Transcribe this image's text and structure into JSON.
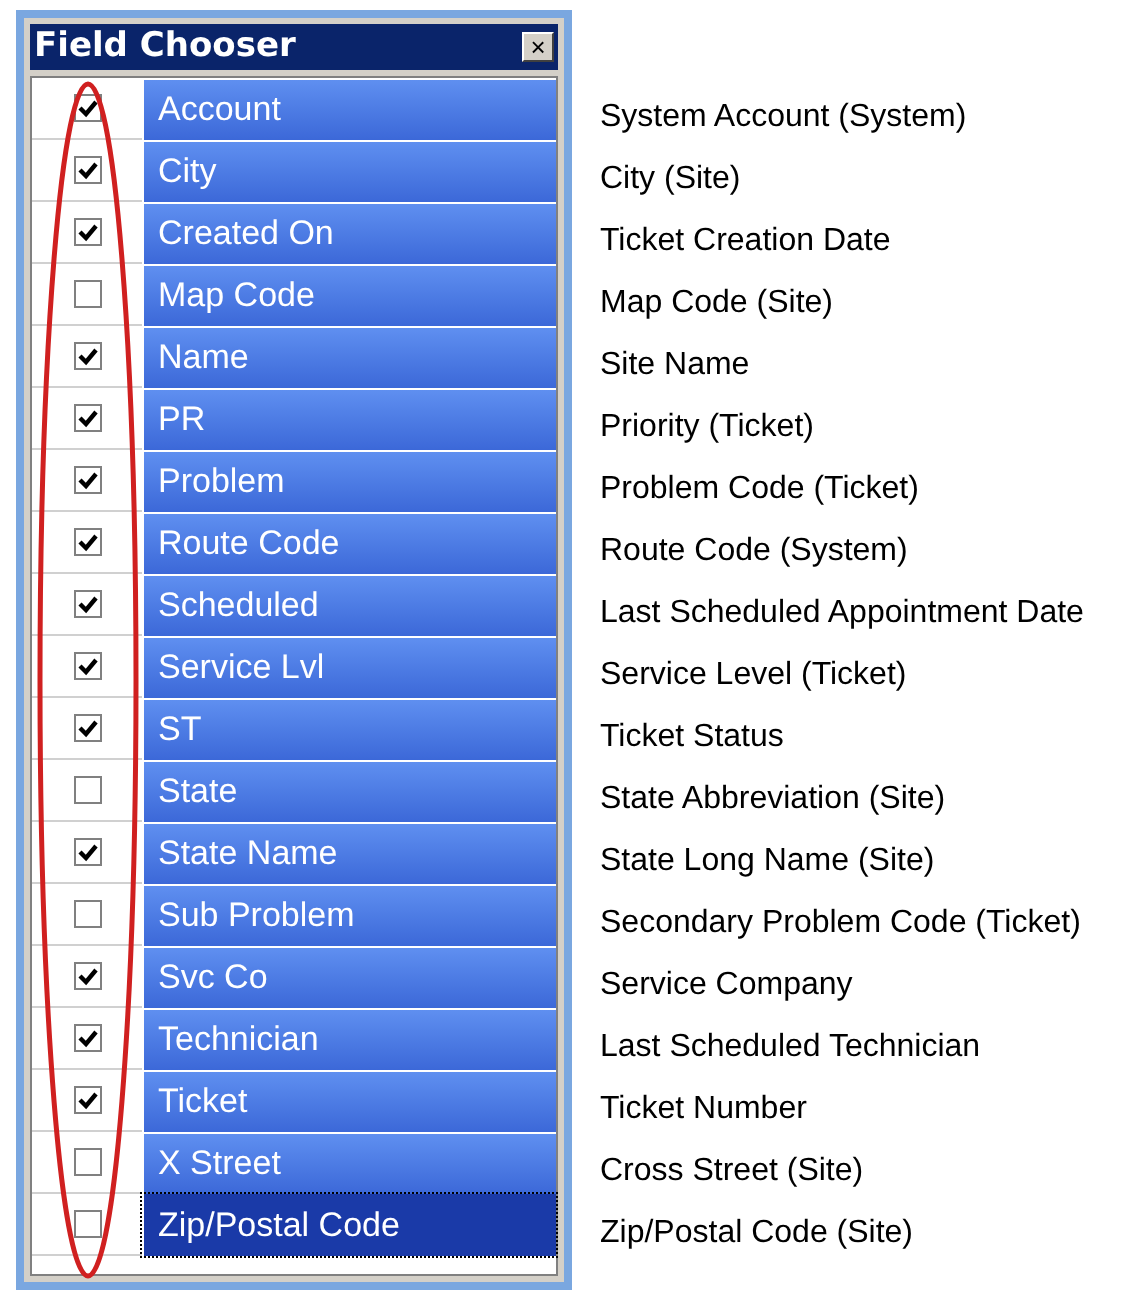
{
  "window": {
    "title": "Field Chooser",
    "close": "×"
  },
  "fields": [
    {
      "label": "Account",
      "description": "System Account (System)",
      "checked": true,
      "selected": false
    },
    {
      "label": "City",
      "description": "City (Site)",
      "checked": true,
      "selected": false
    },
    {
      "label": "Created On",
      "description": "Ticket Creation Date",
      "checked": true,
      "selected": false
    },
    {
      "label": "Map Code",
      "description": "Map Code (Site)",
      "checked": false,
      "selected": false
    },
    {
      "label": "Name",
      "description": "Site Name",
      "checked": true,
      "selected": false
    },
    {
      "label": "PR",
      "description": "Priority (Ticket)",
      "checked": true,
      "selected": false
    },
    {
      "label": "Problem",
      "description": "Problem Code (Ticket)",
      "checked": true,
      "selected": false
    },
    {
      "label": "Route Code",
      "description": "Route Code (System)",
      "checked": true,
      "selected": false
    },
    {
      "label": "Scheduled",
      "description": "Last Scheduled Appointment Date",
      "checked": true,
      "selected": false
    },
    {
      "label": "Service Lvl",
      "description": "Service Level (Ticket)",
      "checked": true,
      "selected": false
    },
    {
      "label": "ST",
      "description": "Ticket Status",
      "checked": true,
      "selected": false
    },
    {
      "label": "State",
      "description": "State Abbreviation (Site)",
      "checked": false,
      "selected": false
    },
    {
      "label": "State Name",
      "description": "State Long Name (Site)",
      "checked": true,
      "selected": false
    },
    {
      "label": "Sub Problem",
      "description": "Secondary Problem Code (Ticket)",
      "checked": false,
      "selected": false
    },
    {
      "label": "Svc Co",
      "description": "Service Company",
      "checked": true,
      "selected": false
    },
    {
      "label": "Technician",
      "description": "Last Scheduled Technician",
      "checked": true,
      "selected": false
    },
    {
      "label": "Ticket",
      "description": "Ticket Number",
      "checked": true,
      "selected": false
    },
    {
      "label": "X Street",
      "description": "Cross Street (Site)",
      "checked": false,
      "selected": false
    },
    {
      "label": "Zip/Postal Code",
      "description": "Zip/Postal Code (Site)",
      "checked": false,
      "selected": true
    }
  ]
}
